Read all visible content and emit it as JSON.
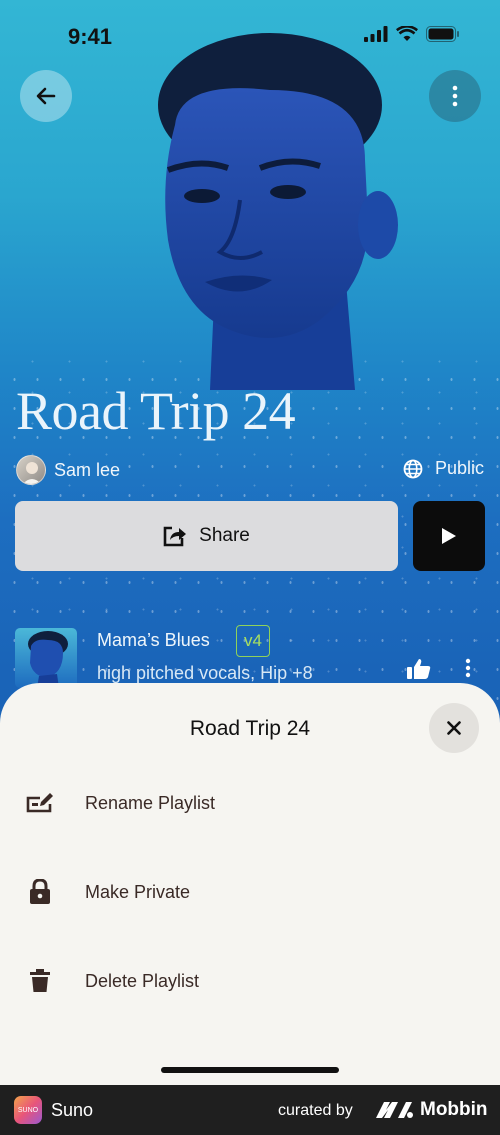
{
  "status_bar": {
    "time": "9:41"
  },
  "header": {
    "back_icon": "arrow-left-icon",
    "menu_icon": "more-vertical-icon"
  },
  "playlist": {
    "title": "Road Trip 24",
    "owner_name": "Sam lee",
    "visibility": "Public",
    "share_label": "Share"
  },
  "songs": [
    {
      "title": "Mama’s Blues",
      "version": "v4",
      "tags": "high pitched vocals, Hip +8"
    }
  ],
  "sheet": {
    "title": "Road Trip 24",
    "items": [
      {
        "label": "Rename Playlist",
        "icon": "rename-icon"
      },
      {
        "label": "Make Private",
        "icon": "lock-icon"
      },
      {
        "label": "Delete Playlist",
        "icon": "trash-icon"
      }
    ]
  },
  "footer": {
    "app_name": "Suno",
    "app_icon_text": "SUNO",
    "curated_by": "curated by",
    "brand": "Mobbin"
  },
  "colors": {
    "bg_top": "#33b6d4",
    "bg_bottom": "#175aaa",
    "badge": "#a8e05f",
    "sheet_bg": "#f6f5f1"
  }
}
